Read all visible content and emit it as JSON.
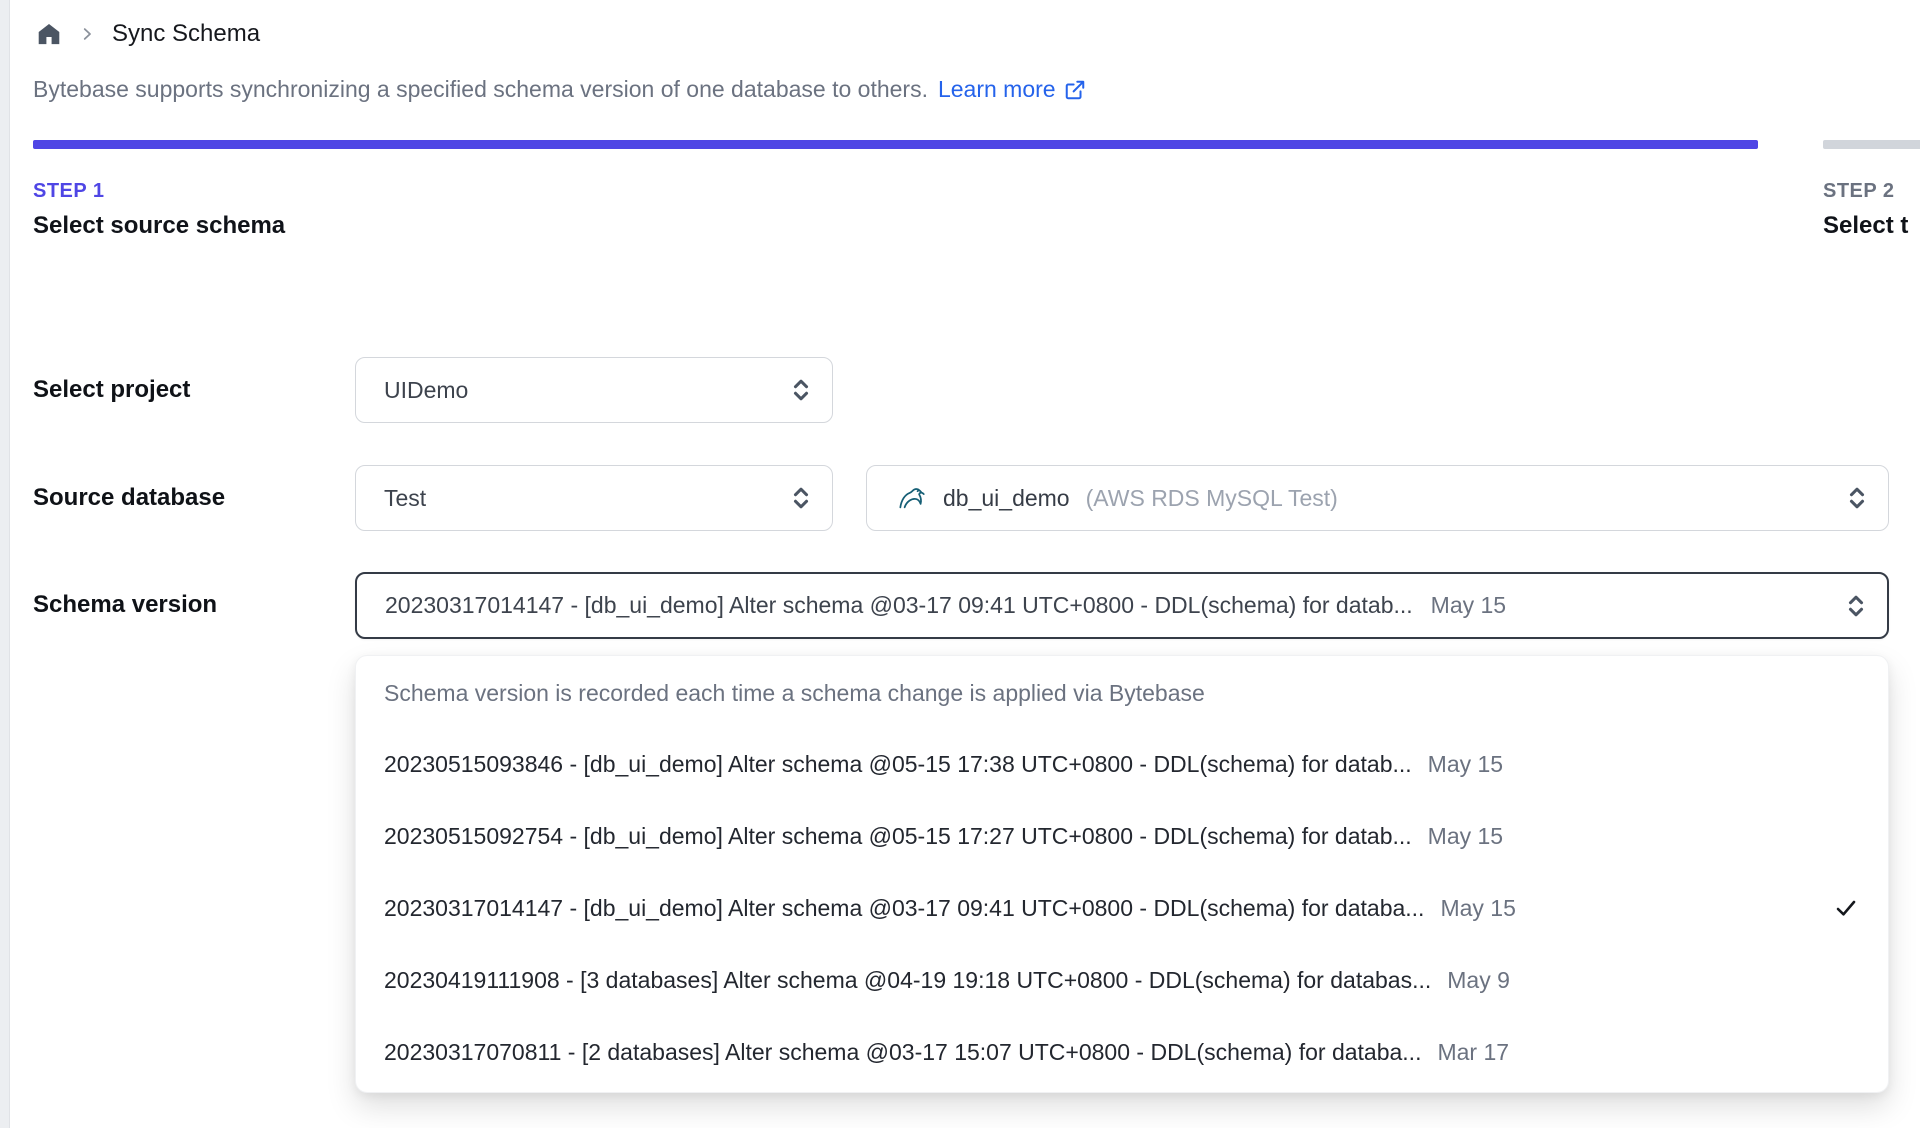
{
  "breadcrumb": {
    "page_title": "Sync Schema"
  },
  "description": {
    "text": "Bytebase supports synchronizing a specified schema version of one database to others.",
    "link_label": "Learn more"
  },
  "steps": [
    {
      "label": "STEP 1",
      "title": "Select source schema"
    },
    {
      "label": "STEP 2",
      "title": "Select t"
    }
  ],
  "form": {
    "project": {
      "label": "Select project",
      "value": "UIDemo"
    },
    "source_database": {
      "label": "Source database",
      "environment_value": "Test",
      "database_value": "db_ui_demo",
      "database_detail": "(AWS RDS MySQL Test)"
    },
    "schema_version": {
      "label": "Schema version",
      "value": "20230317014147 - [db_ui_demo] Alter schema @03-17 09:41 UTC+0800 - DDL(schema) for datab...",
      "date": "May 15"
    }
  },
  "dropdown": {
    "header": "Schema version is recorded each time a schema change is applied via Bytebase",
    "options": [
      {
        "text": "20230515093846 - [db_ui_demo] Alter schema @05-15 17:38 UTC+0800 - DDL(schema) for datab...",
        "date": "May 15",
        "selected": false
      },
      {
        "text": "20230515092754 - [db_ui_demo] Alter schema @05-15 17:27 UTC+0800 - DDL(schema) for datab...",
        "date": "May 15",
        "selected": false
      },
      {
        "text": "20230317014147 - [db_ui_demo] Alter schema @03-17 09:41 UTC+0800 - DDL(schema) for databa...",
        "date": "May 15",
        "selected": true
      },
      {
        "text": "20230419111908 - [3 databases] Alter schema @04-19 19:18 UTC+0800 - DDL(schema) for databas...",
        "date": "May 9",
        "selected": false
      },
      {
        "text": "20230317070811 - [2 databases] Alter schema @03-17 15:07 UTC+0800 - DDL(schema) for databa...",
        "date": "Mar 17",
        "selected": false
      }
    ]
  },
  "icons": {
    "home": "home-icon",
    "breadcrumb_chevron": "chevron-right-icon",
    "external_link": "external-link-icon",
    "select_chevrons": "chevron-up-down-icon",
    "mysql": "mysql-dolphin-icon",
    "check": "check-icon"
  },
  "colors": {
    "accent": "#4f46e5",
    "link": "#2563eb",
    "muted": "#6b7280",
    "faint": "#9ca3af",
    "border": "#d4d7dc",
    "border_focused": "#343b46",
    "bar_gray": "#d1d5db",
    "text_dark": "#23272f",
    "mysql": "#155e75"
  }
}
